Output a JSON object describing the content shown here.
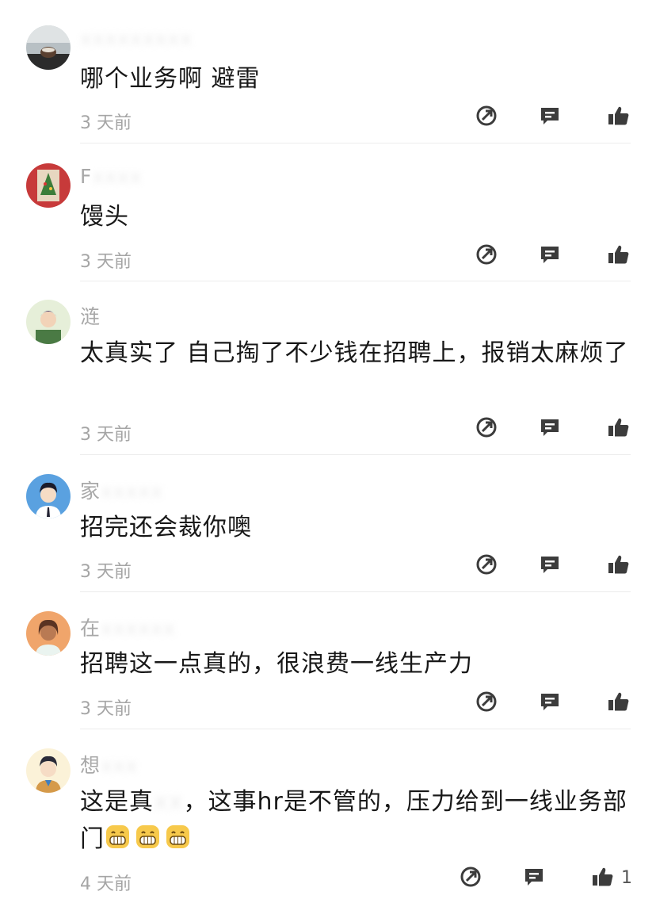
{
  "comments": [
    {
      "name_visible": "",
      "name_blurred": "xxxxxxxxx",
      "text": "哪个业务啊 避雷",
      "time": "3 天前",
      "likes": ""
    },
    {
      "name_visible": "F",
      "name_blurred": "xxxx",
      "text": "馒头",
      "time": "3 天前",
      "likes": ""
    },
    {
      "name_visible": "涟",
      "name_blurred": "",
      "text": "太真实了 自己掏了不少钱在招聘上，报销太麻烦了",
      "time": "3 天前",
      "likes": ""
    },
    {
      "name_visible": "家",
      "name_blurred": "xxxxx",
      "text": "招完还会裁你噢",
      "time": "3 天前",
      "likes": ""
    },
    {
      "name_visible": "在",
      "name_blurred": "xxxxxx",
      "text": "招聘这一点真的，很浪费一线生产力",
      "time": "3 天前",
      "likes": ""
    },
    {
      "name_visible": "想",
      "name_blurred": "xxx",
      "text": "这是真",
      "text_hidden": "xx",
      "text_rest": "，这事hr是不管的，压力给到一线业务部门",
      "emoji": "grin-emoji",
      "time": "4 天前",
      "likes": "1"
    }
  ],
  "icons": {
    "share": "share-icon",
    "reply": "reply-icon",
    "like": "thumbs-up-icon"
  },
  "colors": {
    "icon": "#3c3c3c",
    "time": "#a5a5a5",
    "divider": "#ececec",
    "emoji": "#f7c94b"
  }
}
